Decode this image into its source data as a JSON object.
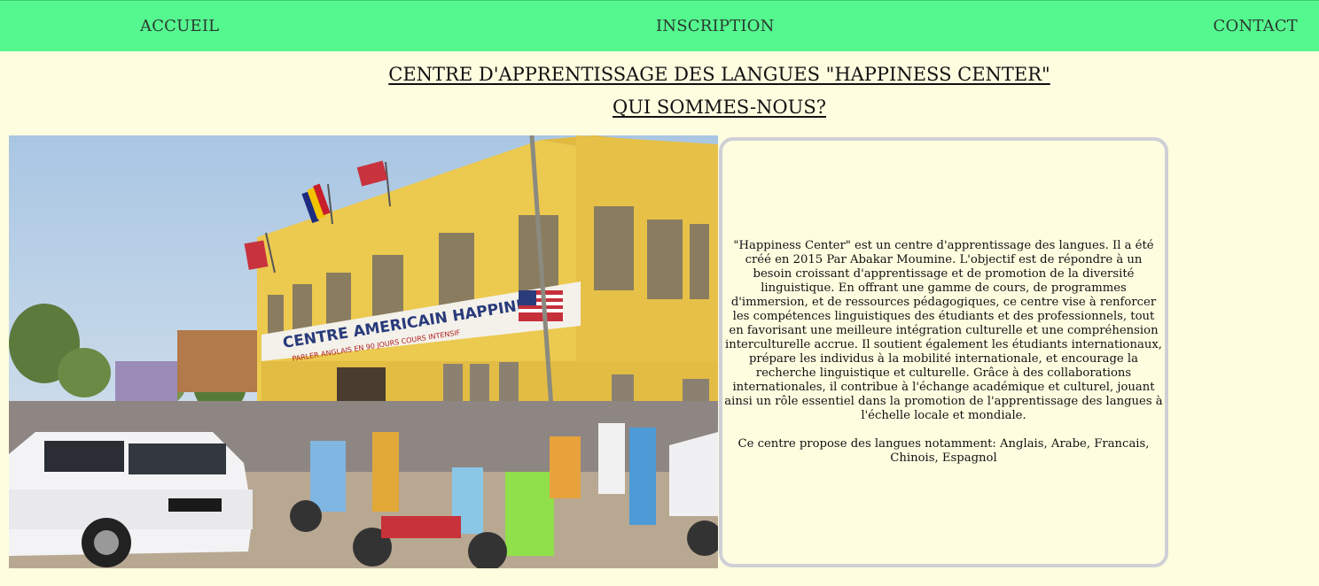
{
  "nav": {
    "accueil": "ACCUEIL",
    "inscription": "INSCRIPTION",
    "contact": "CONTACT"
  },
  "header": {
    "title": "CENTRE D'APPRENTISSAGE DES LANGUES \"HAPPINESS CENTER\"",
    "subtitle": "QUI SOMMES-NOUS?"
  },
  "photo": {
    "sign_main": "CENTRE AMERICAIN HAPPINESS",
    "sign_sub": "PARLER ANGLAIS EN 90 JOURS COURS INTENSIF"
  },
  "about": {
    "paragraph1": "\"Happiness Center\" est un centre d'apprentissage des langues. Il a été créé en 2015 Par Abakar Moumine. L'objectif est de répondre à un besoin croissant d'apprentissage et de promotion de la diversité linguistique. En offrant une gamme de cours, de programmes d'immersion, et de ressources pédagogiques, ce centre vise à renforcer les compétences linguistiques des étudiants et des professionnels, tout en favorisant une meilleure intégration culturelle et une compréhension interculturelle accrue. Il soutient également les étudiants internationaux, prépare les individus à la mobilité internationale, et encourage la recherche linguistique et culturelle. Grâce à des collaborations internationales, il contribue à l'échange académique et culturel, jouant ainsi un rôle essentiel dans la promotion de l'apprentissage des langues à l'échelle locale et mondiale.",
    "paragraph2": "Ce centre propose des langues notamment: Anglais, Arabe, Francais, Chinois, Espagnol"
  },
  "colors": {
    "navbar": "#55f78f",
    "page_background": "#fffde0",
    "box_border": "#cfcfd6"
  }
}
